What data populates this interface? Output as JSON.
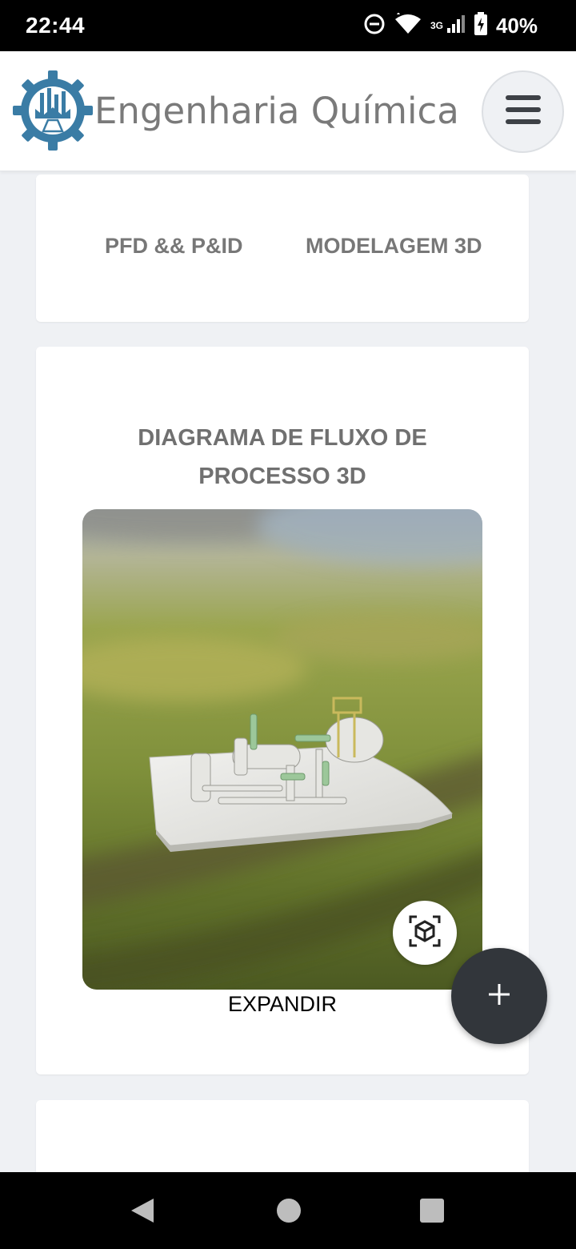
{
  "status_bar": {
    "time": "22:44",
    "network_label": "3G",
    "battery_percent": "40%",
    "icons": [
      "do-not-disturb-icon",
      "wifi-icon",
      "cell-signal-icon",
      "battery-charging-icon"
    ]
  },
  "header": {
    "title": "Engenharia Química",
    "logo_icon": "chemical-engineering-gear-logo",
    "menu_icon": "hamburger-menu-icon"
  },
  "tabs": [
    {
      "label": "PFD && P&ID"
    },
    {
      "label": "MODELAGEM 3D"
    }
  ],
  "main": {
    "title_line1": "DIAGRAMA DE FLUXO DE",
    "title_line2": "PROCESSO 3D",
    "viewer_icon": "ar-cube-icon",
    "expand_label": "EXPANDIR"
  },
  "fab": {
    "icon": "plus-icon"
  },
  "nav_bar": {
    "icons": [
      "back-icon",
      "home-icon",
      "recents-icon"
    ]
  },
  "colors": {
    "accent": "#3a7ca5",
    "fab": "#32363b",
    "muted_text": "#777777"
  }
}
